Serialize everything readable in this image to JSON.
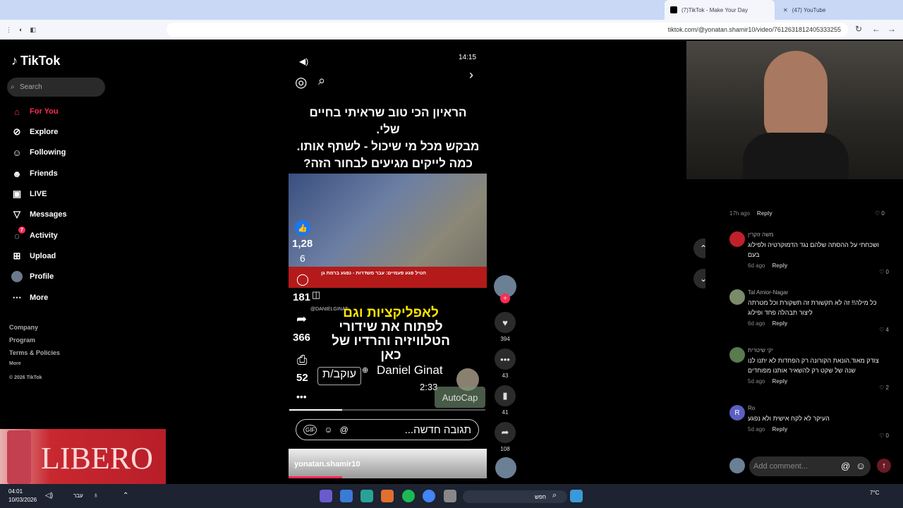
{
  "tabs": [
    {
      "label": "(7)TikTok - Make Your Day"
    },
    {
      "label": "(47) YouTube"
    }
  ],
  "url": "tiktok.com/@yonatan.shamir10/video/7612631812405333255",
  "sidebar": {
    "logo": "TikTok",
    "search_placeholder": "Search",
    "items": [
      {
        "label": "For You"
      },
      {
        "label": "Explore"
      },
      {
        "label": "Following"
      },
      {
        "label": "Friends"
      },
      {
        "label": "LIVE"
      },
      {
        "label": "Messages"
      },
      {
        "label": "Activity",
        "badge": "7"
      },
      {
        "label": "Upload"
      },
      {
        "label": "Profile"
      },
      {
        "label": "More"
      }
    ],
    "footer": [
      "Company",
      "Program",
      "Terms & Policies",
      "More",
      "© 2026 TikTok"
    ]
  },
  "video": {
    "status_time": "14:15",
    "headline_lines": [
      "הראיון הכי טוב שראיתי בחיים שלי.",
      "מבקש מכל מי שיכול - לשתף אותו.",
      "כמה לייקים מגיעים לבחור הזה?"
    ],
    "thumb_caption": "הטיל פגע פעמיים: עבר משדרות - נפגע ברמת גן",
    "inner_likes": "1,28",
    "inner_likes2": "6",
    "inner_comments": "181",
    "inner_shares": "366",
    "inner_saves": "52",
    "handle_small": "@DANIELGINAT",
    "yellow_text": "לאפליקציות וגם",
    "white_text_lines": [
      "לפתוח את שידורי",
      "הטלוויזיה והרדיו של",
      "כאן"
    ],
    "author": "Daniel Ginat",
    "follow_label": "עוקב/ת",
    "duration": "2:33",
    "autocap": "AutoCap",
    "reply_placeholder": "תגובה חדשה...",
    "bottom_handle": "yonatan.shamir10"
  },
  "actions": {
    "likes": "394",
    "comments": "43",
    "saves": "41",
    "shares": "108"
  },
  "comments": [
    {
      "user": "משה זוקרין",
      "text": "ושכחתי על ההסתה שלהם נגד הדמוקרטיה ולפילוג בעם",
      "age": "6d ago",
      "likes": "0"
    },
    {
      "user": "Tal Amior-Nagar",
      "text": "כל מילה!! זה לא תקשורת זה תשקורת וכל מטרתה ליצור תבהלה פחד ופילוג",
      "age": "6d ago",
      "likes": "4"
    },
    {
      "user": "יקי שיטרית",
      "text": "צודק מאוד.הונאת הקורונה רק הפחדות לא יתנו לנו שנה של שקט רק להשאיר אותנו מפוחדים",
      "age": "5d ago",
      "likes": "2"
    },
    {
      "user": "Ro",
      "text": "העיקר לא לקח אישית ולא נפגע",
      "age": "5d ago",
      "likes": "0"
    }
  ],
  "top_comment_meta": {
    "age": "17h ago",
    "likes": "0"
  },
  "reply_label": "Reply",
  "add_comment_placeholder": "Add comment...",
  "ad_text": "LIBERO",
  "taskbar": {
    "time": "04:01",
    "date": "10/03/2026",
    "lang": "עבר",
    "search": "חפש",
    "temp": "7°C"
  }
}
